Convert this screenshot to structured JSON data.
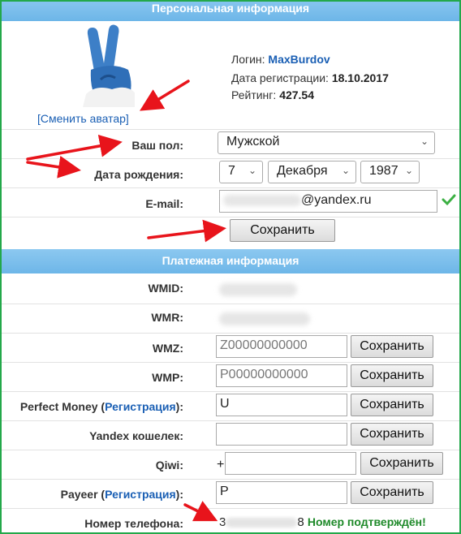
{
  "personal": {
    "header": "Персональная информация",
    "avatar_link": "[Сменить аватар]",
    "login_label": "Логин:",
    "login_value": "MaxBurdov",
    "reg_label": "Дата регистрации:",
    "reg_value": "18.10.2017",
    "rating_label": "Рейтинг:",
    "rating_value": "427.54",
    "gender_label": "Ваш пол:",
    "gender_value": "Мужской",
    "birth_label": "Дата рождения:",
    "birth_day": "7",
    "birth_month": "Декабря",
    "birth_year": "1987",
    "email_label": "E-mail:",
    "email_value": "@yandex.ru",
    "save_label": "Сохранить"
  },
  "payment": {
    "header": "Платежная информация",
    "wmid_label": "WMID:",
    "wmr_label": "WMR:",
    "wmz_label": "WMZ:",
    "wmz_placeholder": "Z00000000000",
    "wmp_label": "WMP:",
    "wmp_placeholder": "P00000000000",
    "pm_label_pre": "Perfect Money (",
    "pm_link": "Регистрация",
    "pm_label_post": "):",
    "pm_value": "U",
    "yandex_label": "Yandex кошелек:",
    "qiwi_label": "Qiwi:",
    "qiwi_prefix": "+",
    "payeer_label_pre": "Payeer (",
    "payeer_link": "Регистрация",
    "payeer_label_post": "):",
    "payeer_value": "P",
    "phone_label": "Номер телефона:",
    "phone_first": "3",
    "phone_last": "8",
    "phone_status": "Номер подтверждён!",
    "save_label": "Сохранить"
  },
  "colors": {
    "header_bg": "#76bbea",
    "border": "#23a84a",
    "link": "#1a5fb4",
    "confirmed": "#1f8a2a",
    "arrow": "#e8141b",
    "checkmark": "#3cb043"
  },
  "icons": {
    "email_valid": "checkmark-icon",
    "dropdown": "chevron-down-icon",
    "annotation": "red-arrow"
  }
}
